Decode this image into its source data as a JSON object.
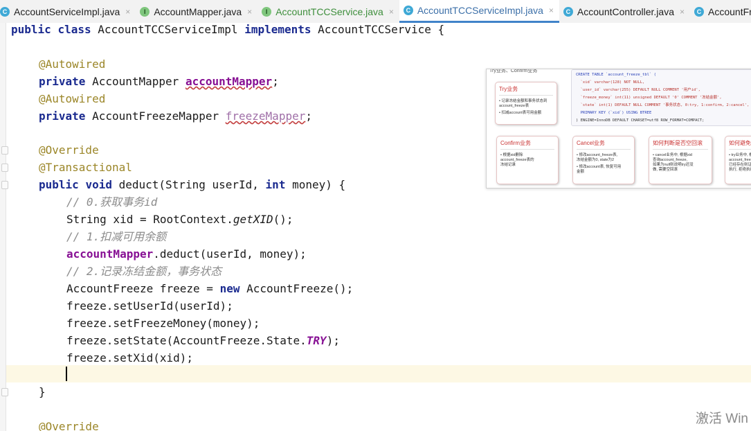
{
  "tabs": [
    {
      "label": "AccountServiceImpl.java",
      "icon": "class-icon",
      "active": false
    },
    {
      "label": "AccountMapper.java",
      "icon": "interface-icon",
      "active": false
    },
    {
      "label": "AccountTCCService.java",
      "icon": "interface-icon",
      "active": false
    },
    {
      "label": "AccountTCCServiceImpl.java",
      "icon": "class-icon",
      "active": true
    },
    {
      "label": "AccountController.java",
      "icon": "class-icon",
      "active": false
    },
    {
      "label": "AccountFreeze.ja",
      "icon": "class-icon",
      "active": false
    }
  ],
  "tab_close_glyph": "×",
  "icon_letters": {
    "class": "C",
    "interface": "I"
  },
  "code": {
    "l1": {
      "kw1": "public",
      "kw2": "class",
      "name": "AccountTCCServiceImpl",
      "kw3": "implements",
      "iface": "AccountTCCService {"
    },
    "l2": {
      "ann": "@Autowired"
    },
    "l3": {
      "kw": "private",
      "type": "AccountMapper",
      "field": "accountMapper",
      "end": ";"
    },
    "l4": {
      "ann": "@Autowired"
    },
    "l5": {
      "kw": "private",
      "type": "AccountFreezeMapper",
      "field": "freezeMapper",
      "end": ";"
    },
    "l6": {
      "ann": "@Override"
    },
    "l7": {
      "ann": "@Transactional"
    },
    "l8": {
      "kw1": "public",
      "kw2": "void",
      "sig1": "deduct(String userId,",
      "kw3": "int",
      "sig2": "money) {"
    },
    "l9": {
      "comment": "// 0.获取事务id"
    },
    "l10": {
      "pre": "String xid = RootContext.",
      "method": "getXID",
      "post": "();"
    },
    "l11": {
      "comment": "// 1.扣减可用余额"
    },
    "l12": {
      "field": "accountMapper",
      "rest": ".deduct(userId, money);"
    },
    "l13": {
      "comment": "// 2.记录冻结金额，事务状态"
    },
    "l14": {
      "pre": "AccountFreeze freeze =",
      "kw": "new",
      "post": "AccountFreeze();"
    },
    "l15": {
      "text": "freeze.setUserId(userId);"
    },
    "l16": {
      "text": "freeze.setFreezeMoney(money);"
    },
    "l17": {
      "pre": "freeze.setState(AccountFreeze.State.",
      "const": "TRY",
      "post": ");"
    },
    "l18": {
      "text": "freeze.setXid(xid);"
    },
    "l19": {
      "text": "}"
    },
    "l20": {
      "ann": "@Override"
    }
  },
  "overlay": {
    "top_text": "Try业务、Confirm业务",
    "sql": [
      "CREATE TABLE `account_freeze_tbl` (",
      "  `xid` varchar(128) NOT NULL,",
      "  `user_id` varchar(255) DEFAULT NULL COMMENT '用户id',",
      "  `freeze_money` int(11) unsigned DEFAULT '0' COMMENT '冻结金额',",
      "  `state` int(1) DEFAULT NULL COMMENT '事务状态, 0:try, 1:confirm, 2:cancel',",
      "  PRIMARY KEY (`xid`) USING BTREE",
      ") ENGINE=InnoDB DEFAULT CHARSET=utf8 ROW_FORMAT=COMPACT;"
    ],
    "cards": [
      {
        "title": "Try业务",
        "items": [
          "记录冻结金额和事务状态到\naccount_freeze表",
          "扣减account表可用金额"
        ]
      },
      {
        "title": "Confirm业务",
        "items": [
          "根据xid删除\naccount_freeze表的\n冻结记录"
        ]
      },
      {
        "title": "Cancel业务",
        "items": [
          "修改account_freeze表,\n冻结金额为0, state为2",
          "修改account表, 恢复可用\n金额"
        ]
      },
      {
        "title": "如何判断是否空回滚",
        "items": [
          "cancel业务中, 根据xid\n查询account_freeze,\n如果为null则说明try还没\n做, 需要空回滚"
        ]
      },
      {
        "title": "如何避免业务悬挂",
        "items": [
          "try业务中, 根据xid查询\naccount_freeze, 如果\n已经存在则证明Cancel已经\n执行, 拒绝执行try业务"
        ]
      }
    ]
  },
  "watermark": "激活 Win"
}
